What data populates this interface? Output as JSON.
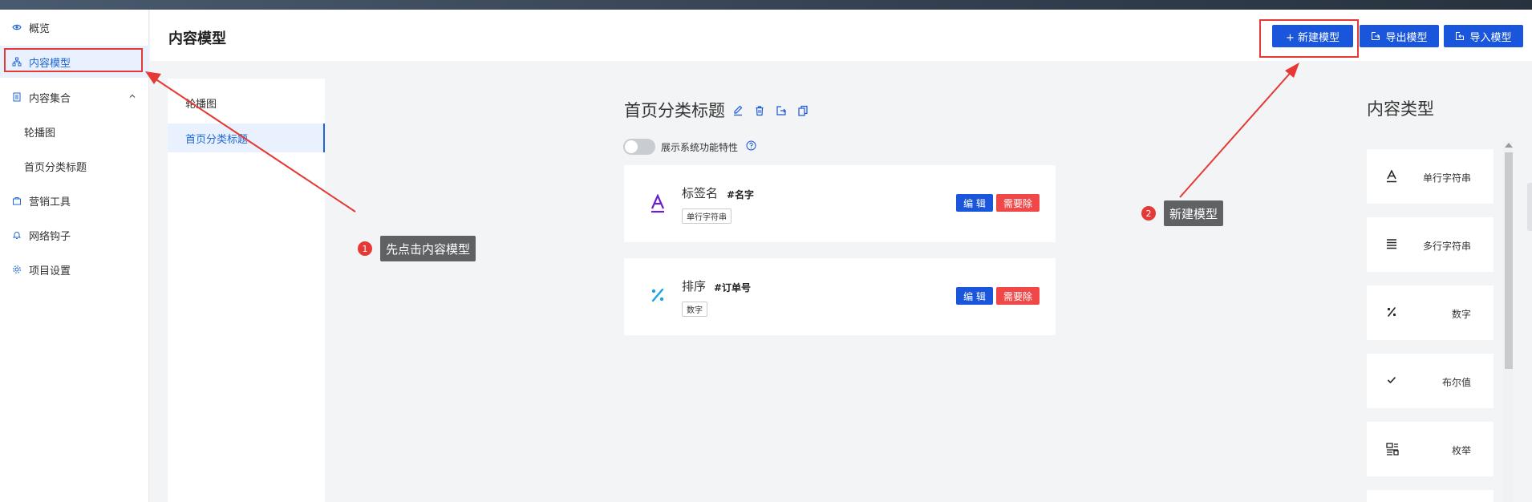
{
  "sidebar": {
    "items": [
      {
        "label": "概览",
        "icon": "eye-icon"
      },
      {
        "label": "内容模型",
        "icon": "sitemap-icon",
        "active": true
      },
      {
        "label": "内容集合",
        "icon": "list-icon",
        "expanded": true
      },
      {
        "label": "轮播图"
      },
      {
        "label": "首页分类标题"
      },
      {
        "label": "营销工具",
        "icon": "bag-icon"
      },
      {
        "label": "网络钩子",
        "icon": "bell-icon"
      },
      {
        "label": "项目设置",
        "icon": "gear-icon"
      }
    ]
  },
  "header": {
    "title": "内容模型",
    "new_model": "+ 新建模型",
    "export_model": "导出模型",
    "import_model": "导入模型"
  },
  "models": {
    "items": [
      "轮播图",
      "首页分类标题"
    ]
  },
  "current_model": {
    "title": "首页分类标题",
    "toggle_label": "展示系统功能特性",
    "fields": [
      {
        "name": "标签名",
        "key": "#名字",
        "type": "单行字符串",
        "icon": "text-a-icon",
        "icon_color": "#6a1fd1"
      },
      {
        "name": "排序",
        "key": "#订单号",
        "type": "数字",
        "icon": "percent-icon",
        "icon_color": "#1aa5e0"
      }
    ],
    "edit_label": "编 辑",
    "delete_label": "需要除"
  },
  "content_types": {
    "title": "内容类型",
    "items": [
      {
        "label": "单行字符串",
        "icon": "text-a-icon"
      },
      {
        "label": "多行字符串",
        "icon": "lines-icon"
      },
      {
        "label": "数字",
        "icon": "percent-icon"
      },
      {
        "label": "布尔值",
        "icon": "check-icon"
      },
      {
        "label": "枚举",
        "icon": "enum-icon"
      }
    ]
  },
  "annotations": [
    {
      "number": "1",
      "text": "先点击内容模型"
    },
    {
      "number": "2",
      "text": "新建模型"
    }
  ],
  "colors": {
    "primary": "#1a56db",
    "danger": "#f04848",
    "annotation": "#e53935",
    "active_bg": "#e8f1fd"
  }
}
